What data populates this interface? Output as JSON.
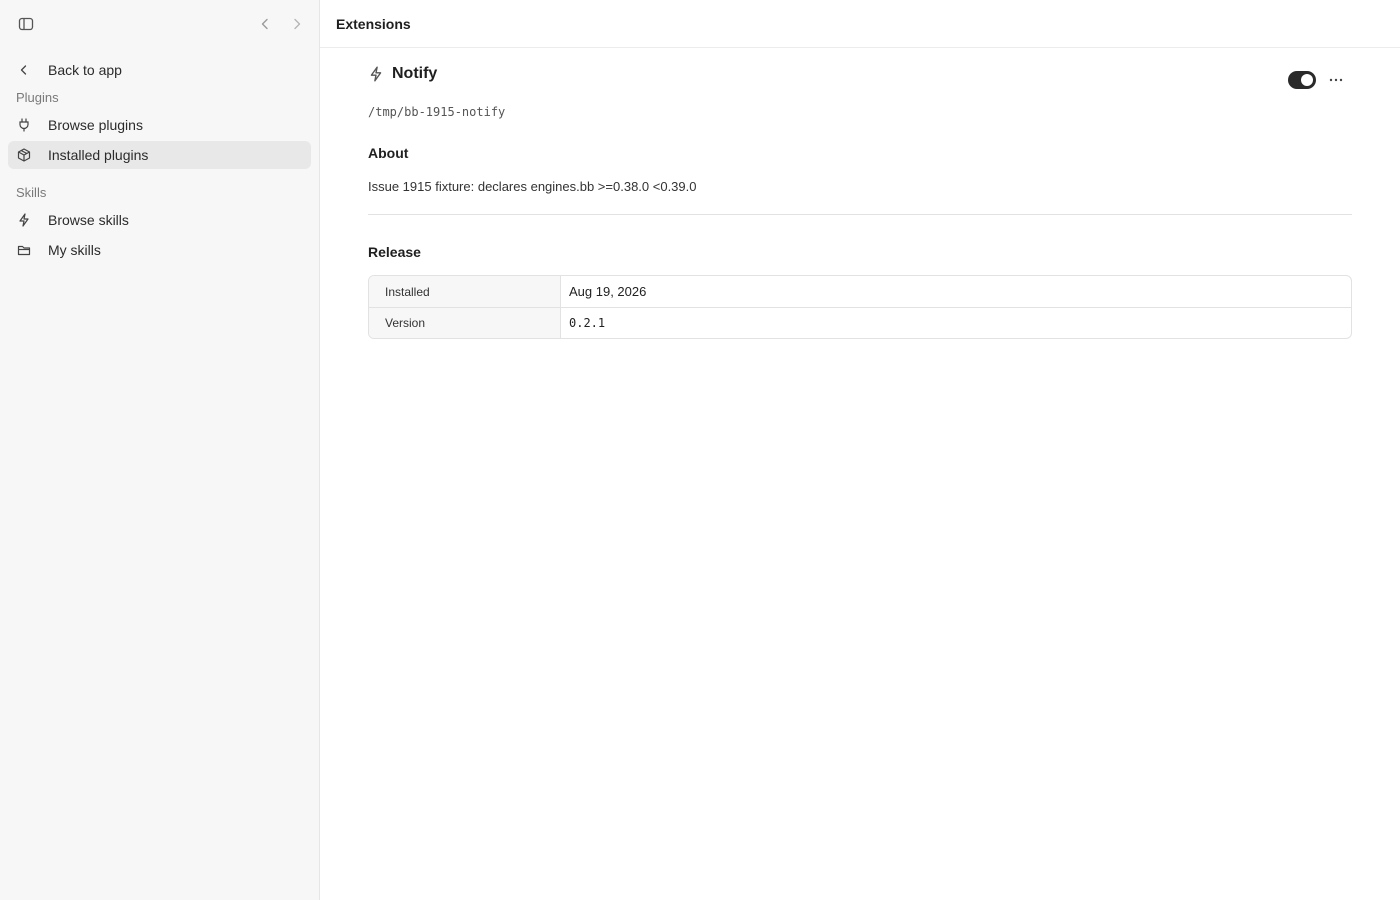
{
  "sidebar": {
    "back_label": "Back to app",
    "sections": {
      "plugins": {
        "label": "Plugins",
        "items": [
          {
            "label": "Browse plugins",
            "icon": "plug-icon"
          },
          {
            "label": "Installed plugins",
            "icon": "package-icon",
            "active": true
          }
        ]
      },
      "skills": {
        "label": "Skills",
        "items": [
          {
            "label": "Browse skills",
            "icon": "lightning-icon"
          },
          {
            "label": "My skills",
            "icon": "folder-icon"
          }
        ]
      }
    }
  },
  "header": {
    "title": "Extensions"
  },
  "extension": {
    "name": "Notify",
    "icon": "lightning-icon",
    "path": "/tmp/bb-1915-notify",
    "enabled": true,
    "about_heading": "About",
    "about_text": "Issue 1915 fixture: declares engines.bb >=0.38.0 <0.39.0",
    "release_heading": "Release",
    "release": [
      {
        "key": "Installed",
        "value": "Aug 19, 2026"
      },
      {
        "key": "Version",
        "value": "0.2.1"
      }
    ]
  },
  "colors": {
    "sidebar_bg": "#f7f7f7",
    "active_item_bg": "#e8e8e8",
    "toggle_on": "#2a2a2a"
  }
}
